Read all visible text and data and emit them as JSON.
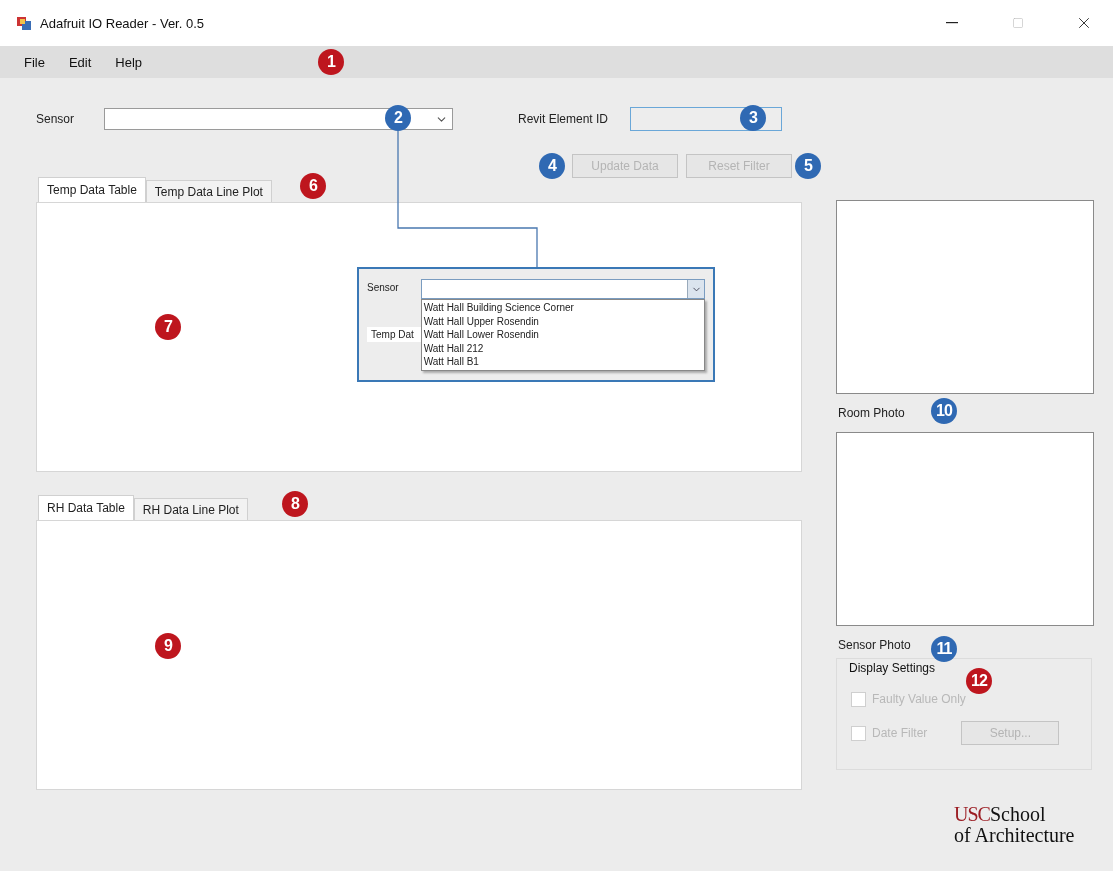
{
  "window": {
    "title": "Adafruit IO Reader - Ver. 0.5"
  },
  "menu": [
    "File",
    "Edit",
    "Help"
  ],
  "sensor": {
    "label": "Sensor"
  },
  "revit": {
    "label": "Revit Element ID"
  },
  "buttons": [
    {
      "label": "Update Data",
      "disabled": true
    },
    {
      "label": "Reset Filter",
      "disabled": true
    }
  ],
  "temp_tabs": [
    {
      "label": "Temp Data Table",
      "selected": true
    },
    {
      "label": "Temp Data Line Plot",
      "selected": false
    }
  ],
  "rh_tabs": [
    {
      "label": "RH Data Table",
      "selected": true
    },
    {
      "label": "RH Data Line Plot",
      "selected": false
    }
  ],
  "inset": {
    "sensor_label": "Sensor",
    "tab_label": "Temp Dat",
    "items": [
      "Watt Hall Building Science Corner",
      "Watt Hall Upper Rosendin",
      "Watt Hall Lower Rosendin",
      "Watt Hall 212",
      "Watt Hall B1"
    ]
  },
  "room_photo": {
    "label": "Room Photo"
  },
  "sensor_photo": {
    "label": "Sensor Photo"
  },
  "display_settings": {
    "title": "Display Settings",
    "options": [
      {
        "label": "Faulty Value Only",
        "checked": false,
        "disabled": true
      },
      {
        "label": "Date Filter",
        "checked": false,
        "disabled": true
      }
    ],
    "setup": {
      "label": "Setup...",
      "disabled": true
    }
  },
  "logo": {
    "mark": "USC",
    "line1": "School",
    "line2": "of Architecture"
  },
  "badges": [
    {
      "number": "1",
      "color": "#be161e"
    },
    {
      "number": "2",
      "color": "#2f69b3"
    },
    {
      "number": "3",
      "color": "#2f69b3"
    },
    {
      "number": "4",
      "color": "#2f69b3"
    },
    {
      "number": "5",
      "color": "#2f69b3"
    },
    {
      "number": "6",
      "color": "#be161e"
    },
    {
      "number": "7",
      "color": "#be161e"
    },
    {
      "number": "8",
      "color": "#be161e"
    },
    {
      "number": "9",
      "color": "#be161e"
    },
    {
      "number": "10",
      "color": "#2f69b3"
    },
    {
      "number": "11",
      "color": "#2f69b3"
    },
    {
      "number": "12",
      "color": "#be161e"
    }
  ]
}
